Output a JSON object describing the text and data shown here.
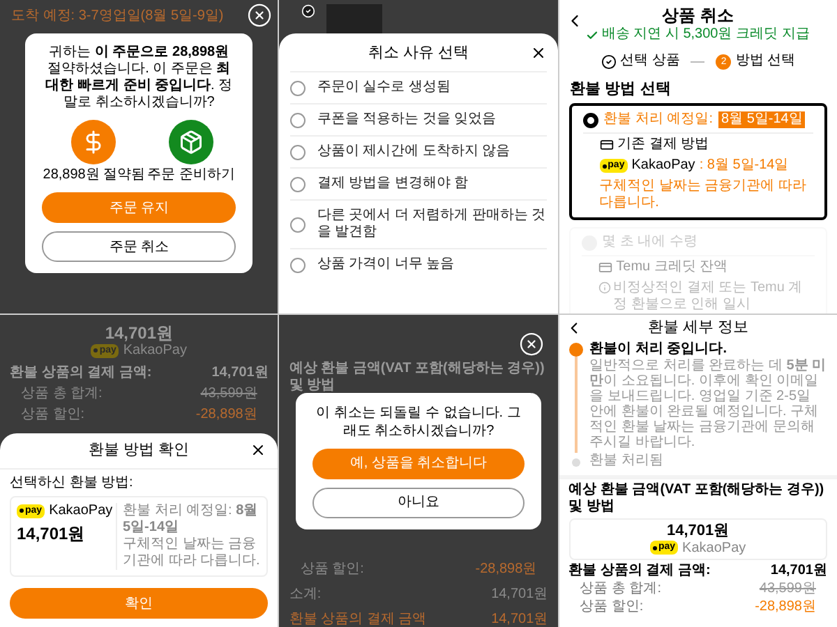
{
  "keep_order_dialog": {
    "background_heading": "도착 예정: 3-7영업일(8월 5일-9일)",
    "message": "귀하는 **이 주문으로 28,898원** 절약하셨습니다. 이 주문은 **최대한 빠르게 준비 중입니다**. 정말로 취소하시겠습니까?",
    "benefits": [
      {
        "kind": "savings",
        "label": "28,898원 절약됨"
      },
      {
        "kind": "preparing",
        "label": "주문 준비하기"
      }
    ],
    "keep_button": "주문 유지",
    "cancel_button": "주문 취소"
  },
  "cancel_reason_sheet": {
    "title": "취소 사유 선택",
    "reasons": [
      {
        "label": "주문이 실수로 생성됨",
        "selected": false
      },
      {
        "label": "쿠폰을 적용하는 것을 잊었음",
        "selected": false
      },
      {
        "label": "상품이 제시간에 도착하지 않음",
        "selected": false
      },
      {
        "label": "결제 방법을 변경해야 함",
        "selected": false
      },
      {
        "label": "다른 곳에서 더 저렴하게 판매하는 것을 발견함",
        "selected": false
      },
      {
        "label": "상품 가격이 너무 높음",
        "selected": false
      }
    ]
  },
  "cancel_item_page": {
    "title": "상품 취소",
    "delay_credit": "배송 지연 시 5,300원 크레딧 지급",
    "steps": [
      {
        "label": "선택 상품",
        "done": true
      },
      {
        "label": "방법 선택",
        "number": "2",
        "done": false
      }
    ],
    "section_title": "환불 방법 선택",
    "methods": [
      {
        "selected": true,
        "disabled": false,
        "title": "환불 처리 예정일:",
        "badge": "8월 5일-14일",
        "source": "기존 결제 방법",
        "provider_logo": "pay",
        "provider": "KakaoPay",
        "provider_date": ": 8월 5일-14일",
        "note": "구체적인 날짜는 금융기관에 따라 다릅니다."
      },
      {
        "selected": false,
        "disabled": true,
        "title": "몇 초 내에 수령",
        "source": "Temu 크레딧 잔액",
        "info": "비정상적인 결제 또는 Temu 계정 환불으로 인해 일시"
      }
    ]
  },
  "refund_confirm_sheet": {
    "background": {
      "amount": "14,701원",
      "provider_logo": "pay",
      "provider": "KakaoPay",
      "rows": [
        {
          "label": "환불 상품의 결제 금액:",
          "value": "14,701원",
          "kind": "total"
        },
        {
          "label": "상품 총 합계:",
          "value": "43,599원",
          "kind": "struck"
        },
        {
          "label": "상품 할인:",
          "value": "-28,898원",
          "kind": "discount"
        }
      ]
    },
    "title": "환불 방법 확인",
    "method_label": "선택하신 환불 방법:",
    "provider_logo": "pay",
    "provider": "KakaoPay",
    "amount": "14,701원",
    "schedule": "환불 처리 예정일: **8월 5일-14일**",
    "note": "구체적인 날짜는 금융기관에 따라 다릅니다.",
    "confirm_button": "확인"
  },
  "confirm_cancel_dialog": {
    "background_heading": "예상 환불 금액(VAT 포함(해당하는 경우)) 및 방법",
    "background_rows": [
      {
        "label": "상품 할인:",
        "value": "-28,898원",
        "kind": "discount"
      },
      {
        "label": "소계:",
        "value": "14,701원",
        "kind": "plain"
      },
      {
        "label": "환불 상품의 결제 금액",
        "value": "14,701원",
        "kind": "highlight"
      }
    ],
    "message": "이 취소는 되돌릴 수 없습니다. 그래도 취소하시겠습니까?",
    "yes_button": "예, 상품을 취소합니다",
    "no_button": "아니요"
  },
  "refund_details_page": {
    "title": "환불 세부 정보",
    "timeline": [
      {
        "title": "환불이 처리 중입니다.",
        "description": "일반적으로 처리를 완료하는 데 **5분 미만**이 소요됩니다. 이후에 확인 이메일을 보내드립니다. 영업일 기준 2-5일 안에 환불이 완료될 예정입니다. 구체적인 환불 날짜는 금융기관에 문의해 주시길 바랍니다.",
        "current": true
      },
      {
        "title": "환불 처리됨",
        "current": false
      }
    ],
    "section_title": "예상 환불 금액(VAT 포함(해당하는 경우)) 및 방법",
    "amount": "14,701원",
    "provider_logo": "pay",
    "provider": "KakaoPay",
    "rows": [
      {
        "label": "환불 상품의 결제 금액:",
        "value": "14,701원",
        "kind": "total"
      },
      {
        "label": "상품 총 합계:",
        "value": "43,599원",
        "kind": "struck"
      },
      {
        "label": "상품 할인:",
        "value": "-28,898원",
        "kind": "discount"
      }
    ]
  }
}
